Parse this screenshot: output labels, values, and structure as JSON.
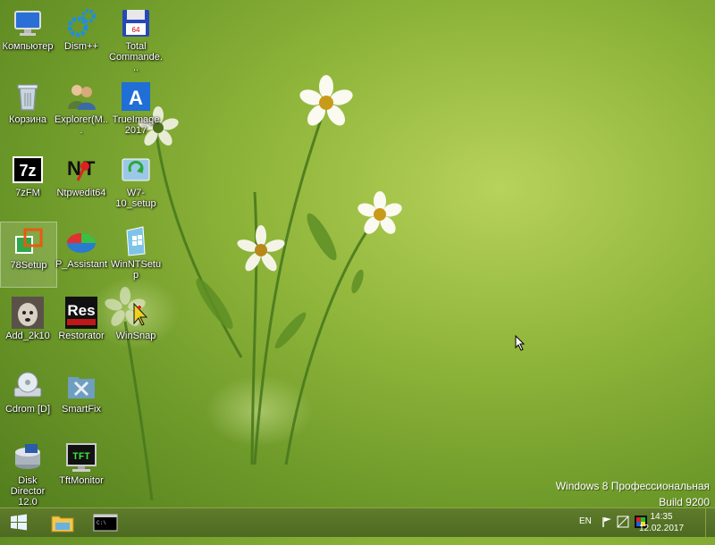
{
  "desktop": {
    "icons": [
      {
        "label": "Компьютер",
        "icon": "computer-icon"
      },
      {
        "label": "Dism++",
        "icon": "gears-icon"
      },
      {
        "label": "Total Commande...",
        "icon": "floppy-icon"
      },
      {
        "label": "Корзина",
        "icon": "recycle-bin-icon"
      },
      {
        "label": "Explorer(M...",
        "icon": "users-icon"
      },
      {
        "label": "TrueImage 2017",
        "icon": "acronis-icon"
      },
      {
        "label": "7zFM",
        "icon": "7zip-icon"
      },
      {
        "label": "Ntpwedit64",
        "icon": "key-icon"
      },
      {
        "label": "W7-10_setup",
        "icon": "setup-icon"
      },
      {
        "label": "78Setup",
        "icon": "windows-setup-icon"
      },
      {
        "label": "P_Assistant",
        "icon": "partition-icon"
      },
      {
        "label": "WinNTSetup",
        "icon": "winntsetup-icon"
      },
      {
        "label": "Add_2k10",
        "icon": "dog-icon"
      },
      {
        "label": "Restorator",
        "icon": "res-icon"
      },
      {
        "label": "WinSnap",
        "icon": "winsnap-icon"
      },
      {
        "label": "Cdrom [D]",
        "icon": "cdrom-icon"
      },
      {
        "label": "SmartFix",
        "icon": "toolbox-icon"
      },
      {
        "label": "Disk Director 12.0",
        "icon": "disk-director-icon"
      },
      {
        "label": "TftMonitor",
        "icon": "monitor-icon"
      }
    ]
  },
  "watermark": {
    "line1": "Windows 8 Профессиональная",
    "line2": "Build 9200"
  },
  "taskbar": {
    "language": "EN",
    "time": "14:35",
    "date": "12.02.2017"
  }
}
